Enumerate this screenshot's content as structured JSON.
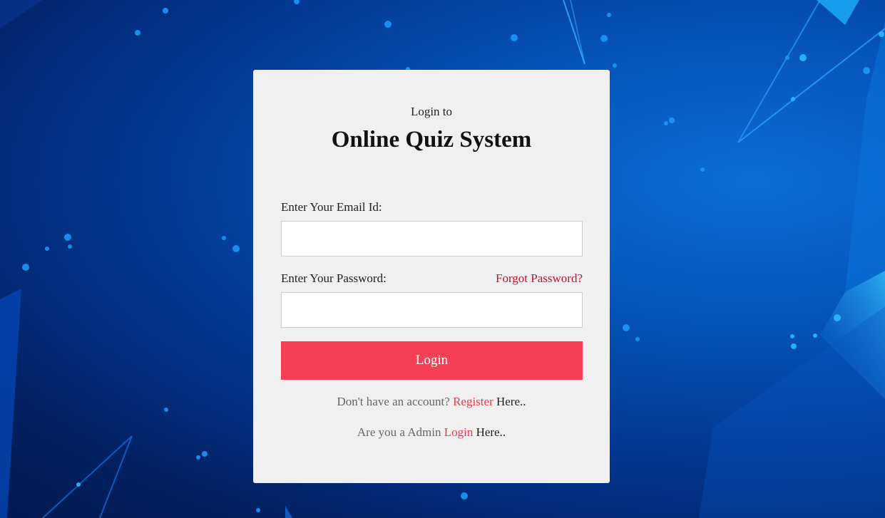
{
  "login_card": {
    "subtitle": "Login to",
    "title": "Online Quiz System",
    "email_label": "Enter Your Email Id:",
    "email_value": "",
    "password_label": "Enter Your Password:",
    "password_value": "",
    "forgot_password_link": "Forgot Password?",
    "login_button": "Login",
    "register_prompt": "Don't have an account?",
    "register_link": "Register",
    "register_suffix": " Here..",
    "admin_prompt": "Are you a Admin",
    "admin_link": "Login",
    "admin_suffix": " Here.."
  },
  "colors": {
    "accent": "#f53f54",
    "link_red": "#c4122f",
    "card_bg": "#f0f0f0",
    "background_dark": "#021f5e",
    "background_light": "#0a6fd6"
  }
}
